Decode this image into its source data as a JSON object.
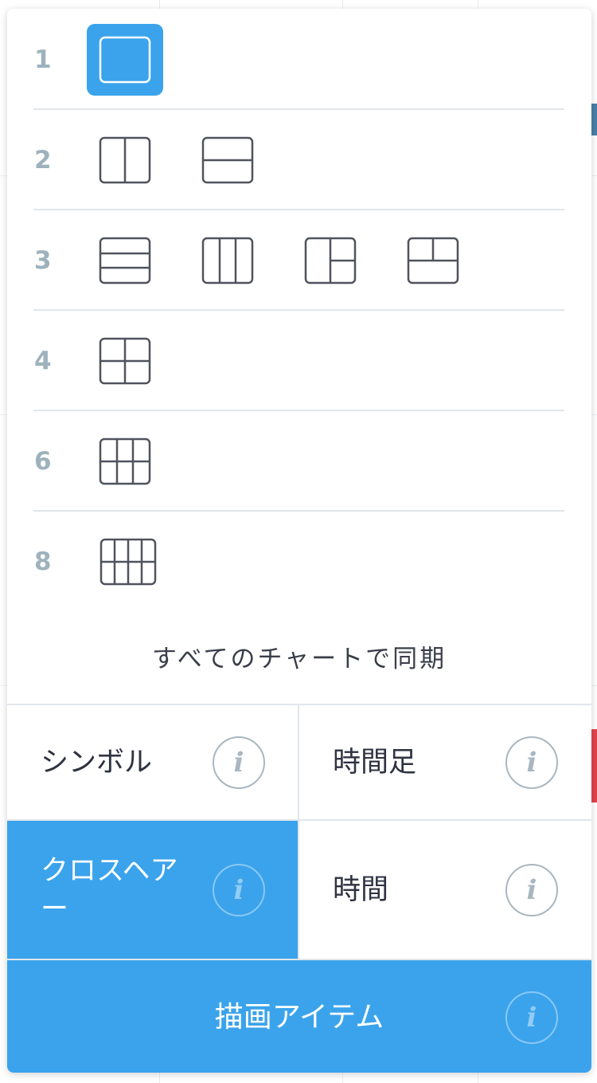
{
  "layouts": {
    "rows": [
      {
        "count_label": "1",
        "options": [
          "layout-1"
        ],
        "selected": 0
      },
      {
        "count_label": "2",
        "options": [
          "layout-2-vertical",
          "layout-2-horizontal"
        ]
      },
      {
        "count_label": "3",
        "options": [
          "layout-3-rows",
          "layout-3-columns",
          "layout-3-left-big",
          "layout-3-top-big"
        ]
      },
      {
        "count_label": "4",
        "options": [
          "layout-4-grid"
        ]
      },
      {
        "count_label": "6",
        "options": [
          "layout-6-grid"
        ]
      },
      {
        "count_label": "8",
        "options": [
          "layout-8-grid"
        ]
      }
    ]
  },
  "sync": {
    "title": "すべてのチャートで同期",
    "symbol_label": "シンボル",
    "interval_label": "時間足",
    "crosshair_label": "クロスヘア ー",
    "time_label": "時間",
    "drawings_label": "描画アイテム",
    "info_glyph": "i"
  },
  "colors": {
    "accent": "#3aa3ec",
    "number_color": "#9db2bd",
    "icon_stroke": "#50535e"
  }
}
